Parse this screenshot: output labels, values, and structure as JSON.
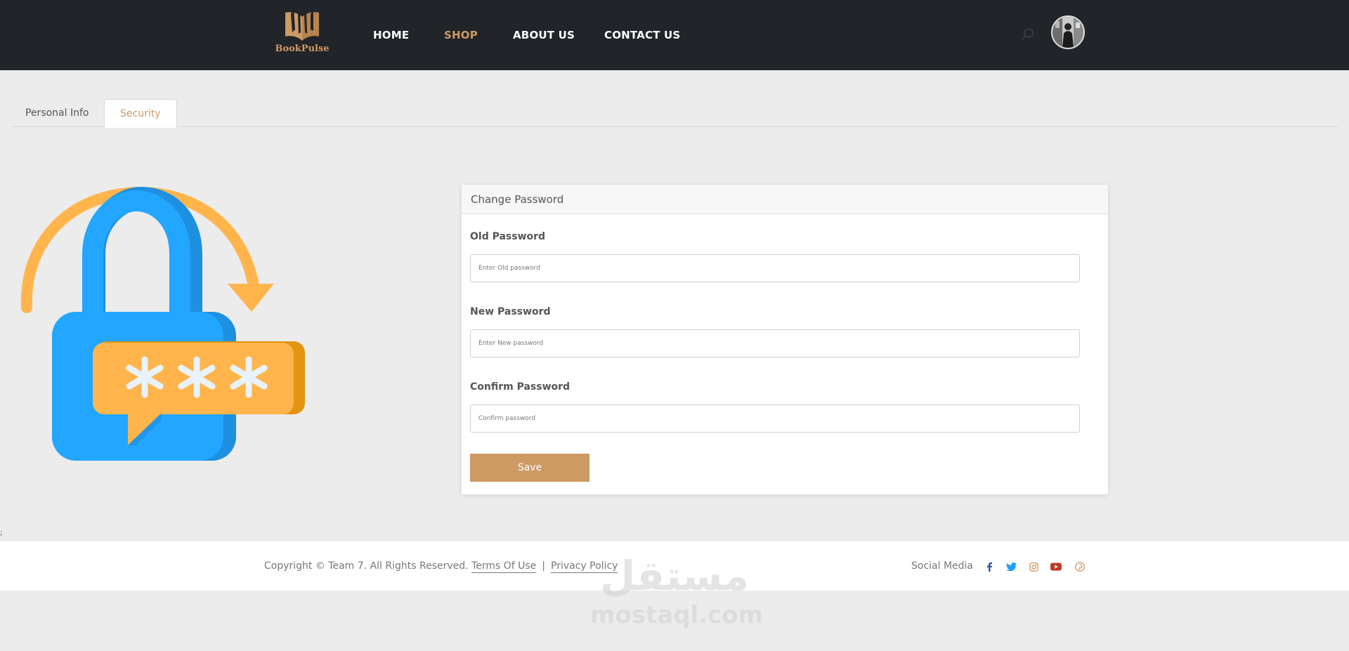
{
  "brand": {
    "name": "BookPulse",
    "accent": "#cd9a64",
    "nav_bg": "#212429"
  },
  "nav": {
    "home": "HOME",
    "shop": "SHOP",
    "about": "ABOUT US",
    "contact": "CONTACT US",
    "active": "SHOP",
    "search_icon": "search-icon",
    "avatar_icon": "user-avatar"
  },
  "tabs": {
    "personal": "Personal Info",
    "security": "Security",
    "active": "Security"
  },
  "illustration": {
    "icon": "password-reset-lock-icon",
    "masked_text": "***"
  },
  "card": {
    "title": "Change Password",
    "old_label": "Old Password",
    "old_placeholder": "Enter Old password",
    "new_label": "New Password",
    "new_placeholder": "Enter New password",
    "confirm_label": "Confirm Password",
    "confirm_placeholder": "Confirm password",
    "save_label": "Save"
  },
  "stray_text": ";",
  "footer": {
    "copyright": "Copyright © Team 7. All Rights Reserved.",
    "terms": "Terms Of Use",
    "separator": "|",
    "privacy": "Privacy Policy",
    "social_label": "Social Media",
    "social_icons": [
      "facebook-icon",
      "twitter-icon",
      "instagram-icon",
      "youtube-icon",
      "pinterest-icon"
    ]
  },
  "watermark": {
    "arabic": "مستقل",
    "latin": "mostaql.com"
  }
}
